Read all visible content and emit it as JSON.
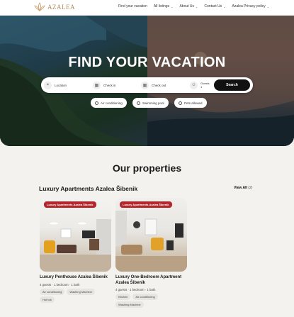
{
  "nav": {
    "logo_text": "AZALEA",
    "items": [
      {
        "label": "Find your vacation",
        "has_chevron": false
      },
      {
        "label": "All listings",
        "has_chevron": true
      },
      {
        "label": "About Us",
        "has_chevron": true
      },
      {
        "label": "Contact Us",
        "has_chevron": true
      },
      {
        "label": "Azalea Privacy policy",
        "has_chevron": true
      }
    ]
  },
  "hero": {
    "title": "FIND YOUR VACATION"
  },
  "search": {
    "location_label": "Location",
    "checkin_label": "Check in",
    "checkout_label": "Check out",
    "guests_label": "Guests",
    "guests_value": "1",
    "button_label": "Search"
  },
  "filters": [
    {
      "label": "Air conditioning"
    },
    {
      "label": "Swimming pool"
    },
    {
      "label": "Pets allowed"
    }
  ],
  "properties": {
    "section_title": "Our properties",
    "city_title": "Luxury Apartments Azalea Šibenik",
    "view_all_label": "View All",
    "view_all_count": "(2)",
    "cards": [
      {
        "badge": "Luxury Apartments Azalea Šibenik",
        "name": "Luxury Penthouse Azalea Šibenik",
        "meta": "4 guests · 1 bedroom · 1 bath",
        "tags": [
          "Air conditioning",
          "Washing Machine",
          "Hot tub"
        ]
      },
      {
        "badge": "Luxury Apartments Azalea Šibenik",
        "name": "Luxury One-Bedroom Apartment Azalea Šibenik",
        "meta": "4 guests · 1 bedroom · 1 bath",
        "tags": [
          "Kitchen",
          "Air conditioning",
          "Washing Machine"
        ]
      }
    ]
  }
}
